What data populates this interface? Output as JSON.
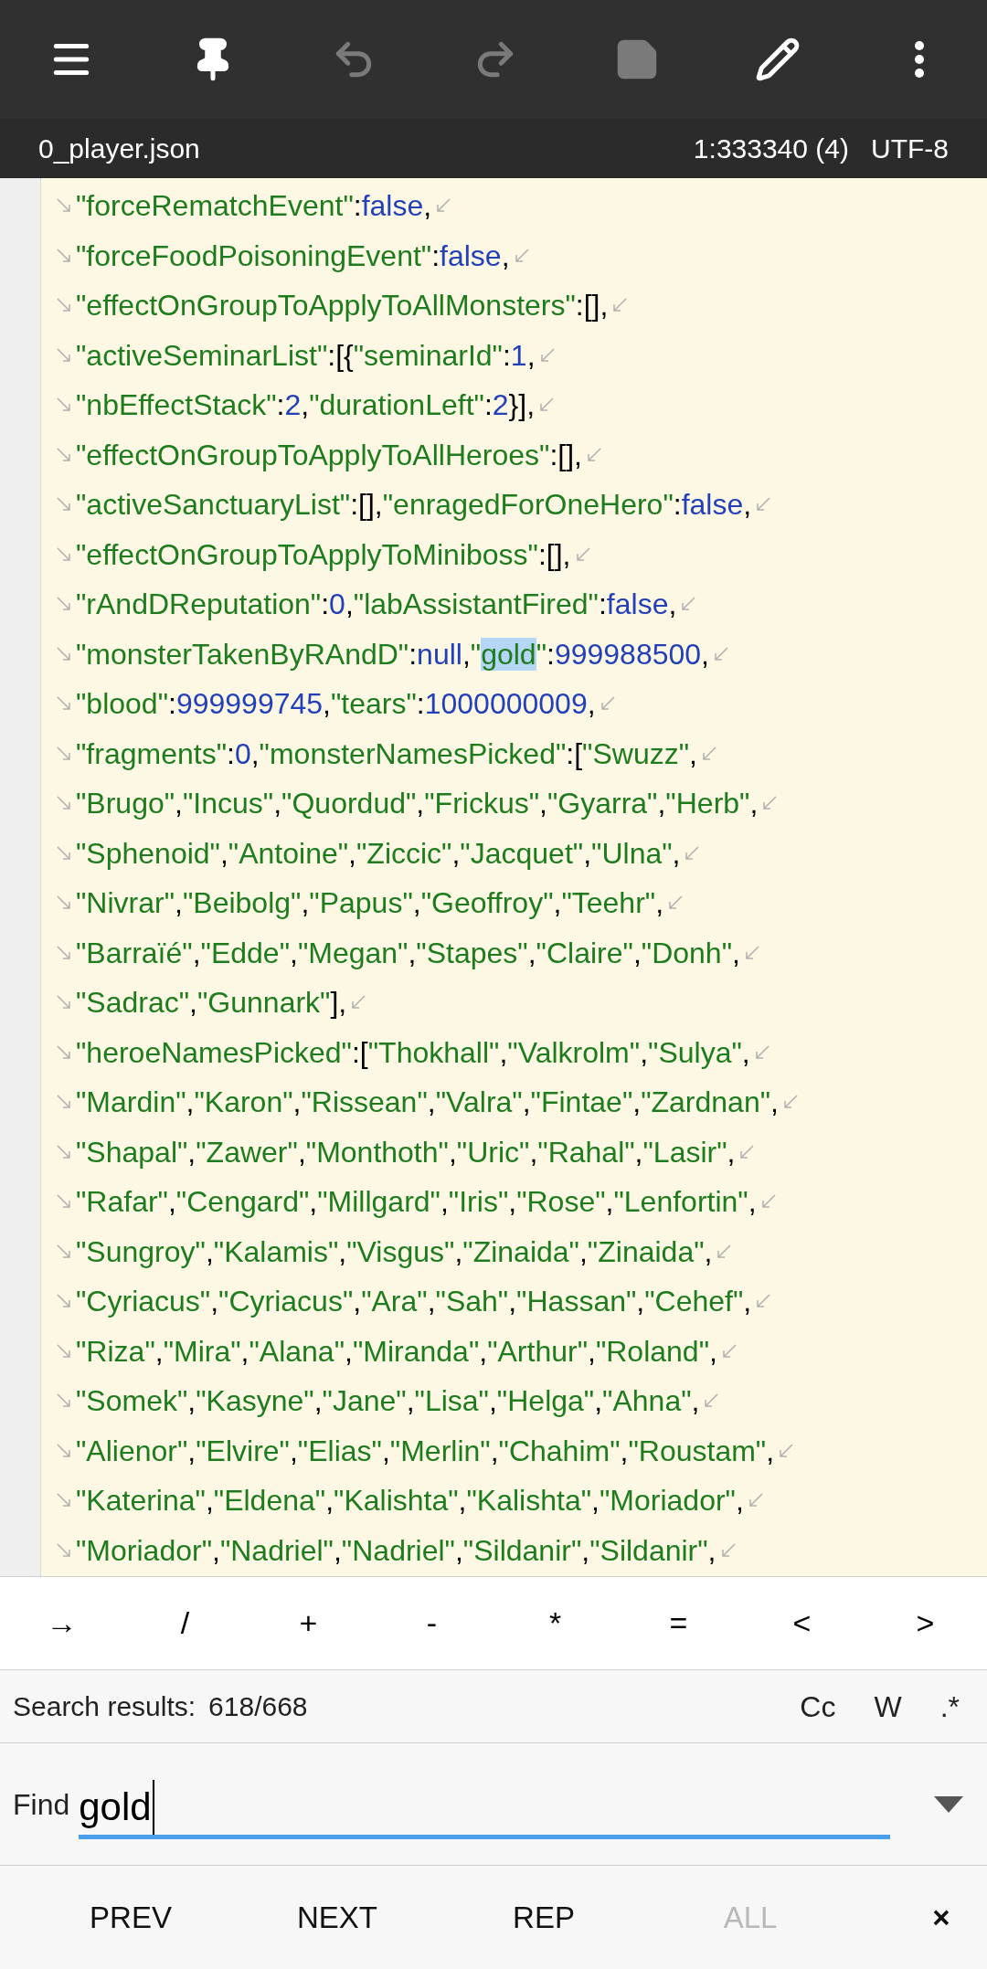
{
  "toolbar": {
    "buttons": [
      {
        "kind": "menu",
        "disabled": false
      },
      {
        "kind": "pin",
        "disabled": false
      },
      {
        "kind": "undo",
        "disabled": true
      },
      {
        "kind": "redo",
        "disabled": true
      },
      {
        "kind": "save",
        "disabled": true
      },
      {
        "kind": "edit",
        "disabled": false
      },
      {
        "kind": "more",
        "disabled": false
      }
    ]
  },
  "file_bar": {
    "filename": "0_player.json",
    "position": "1:333340 (4)",
    "encoding": "UTF-8"
  },
  "editor": {
    "lines": [
      {
        "segments": [
          "\"forceRematchEvent\":false,"
        ]
      },
      {
        "segments": [
          "\"forceFoodPoisoningEvent\":false,"
        ]
      },
      {
        "segments": [
          "\"effectOnGroupToApplyToAllMonsters\":[],"
        ]
      },
      {
        "segments": [
          "\"activeSeminarList\":[{\"seminarId\":1,"
        ]
      },
      {
        "segments": [
          "\"nbEffectStack\":2,\"durationLeft\":2}],"
        ]
      },
      {
        "segments": [
          "\"effectOnGroupToApplyToAllHeroes\":[],"
        ]
      },
      {
        "segments": [
          "\"activeSanctuaryList\":[],\"enragedForOneHero\":false,"
        ]
      },
      {
        "segments": [
          "\"effectOnGroupToApplyToMiniboss\":[],"
        ]
      },
      {
        "segments": [
          "\"rAndDReputation\":0,\"labAssistantFired\":false,"
        ]
      },
      {
        "segments": [
          "\"monsterTakenByRAndD\":null,\"",
          "gold",
          "\":999988500,"
        ],
        "match": [
          false,
          true,
          false
        ]
      },
      {
        "segments": [
          "\"blood\":999999745,\"tears\":1000000009,"
        ]
      },
      {
        "segments": [
          "\"fragments\":0,\"monsterNamesPicked\":[\"Swuzz\","
        ]
      },
      {
        "segments": [
          "\"Brugo\",\"Incus\",\"Quordud\",\"Frickus\",\"Gyarra\",\"Herb\","
        ]
      },
      {
        "segments": [
          "\"Sphenoid\",\"Antoine\",\"Ziccic\",\"Jacquet\",\"Ulna\","
        ]
      },
      {
        "segments": [
          "\"Nivrar\",\"Beibolg\",\"Papus\",\"Geoffroy\",\"Teehr\","
        ]
      },
      {
        "segments": [
          "\"Barraïé\",\"Edde\",\"Megan\",\"Stapes\",\"Claire\",\"Donh\","
        ]
      },
      {
        "segments": [
          "\"Sadrac\",\"Gunnark\"],"
        ]
      },
      {
        "segments": [
          "\"heroeNamesPicked\":[\"Thokhall\",\"Valkrolm\",\"Sulya\","
        ]
      },
      {
        "segments": [
          "\"Mardin\",\"Karon\",\"Rissean\",\"Valra\",\"Fintae\",\"Zardnan\","
        ]
      },
      {
        "segments": [
          "\"Shapal\",\"Zawer\",\"Monthoth\",\"Uric\",\"Rahal\",\"Lasir\","
        ]
      },
      {
        "segments": [
          "\"Rafar\",\"Cengard\",\"Millgard\",\"Iris\",\"Rose\",\"Lenfortin\","
        ]
      },
      {
        "segments": [
          "\"Sungroy\",\"Kalamis\",\"Visgus\",\"Zinaida\",\"Zinaida\","
        ]
      },
      {
        "segments": [
          "\"Cyriacus\",\"Cyriacus\",\"Ara\",\"Sah\",\"Hassan\",\"Cehef\","
        ]
      },
      {
        "segments": [
          "\"Riza\",\"Mira\",\"Alana\",\"Miranda\",\"Arthur\",\"Roland\","
        ]
      },
      {
        "segments": [
          "\"Somek\",\"Kasyne\",\"Jane\",\"Lisa\",\"Helga\",\"Ahna\","
        ]
      },
      {
        "segments": [
          "\"Alienor\",\"Elvire\",\"Elias\",\"Merlin\",\"Chahim\",\"Roustam\","
        ]
      },
      {
        "segments": [
          "\"Katerina\",\"Eldena\",\"Kalishta\",\"Kalishta\",\"Moriador\","
        ]
      },
      {
        "segments": [
          "\"Moriador\",\"Nadriel\",\"Nadriel\",\"Sildanir\",\"Sildanir\","
        ]
      }
    ]
  },
  "symbol_bar": {
    "keys": [
      "→",
      "/",
      "+",
      "-",
      "*",
      "=",
      "<",
      ">"
    ]
  },
  "search": {
    "results_label": "Search results:",
    "results_count": "618/668",
    "options": [
      "Cc",
      "W",
      ".*"
    ],
    "find_label": "Find",
    "value": "gold"
  },
  "actions": [
    {
      "label": "PREV",
      "disabled": false
    },
    {
      "label": "NEXT",
      "disabled": false
    },
    {
      "label": "REP",
      "disabled": false
    },
    {
      "label": "ALL",
      "disabled": true
    }
  ],
  "close_button": "×"
}
